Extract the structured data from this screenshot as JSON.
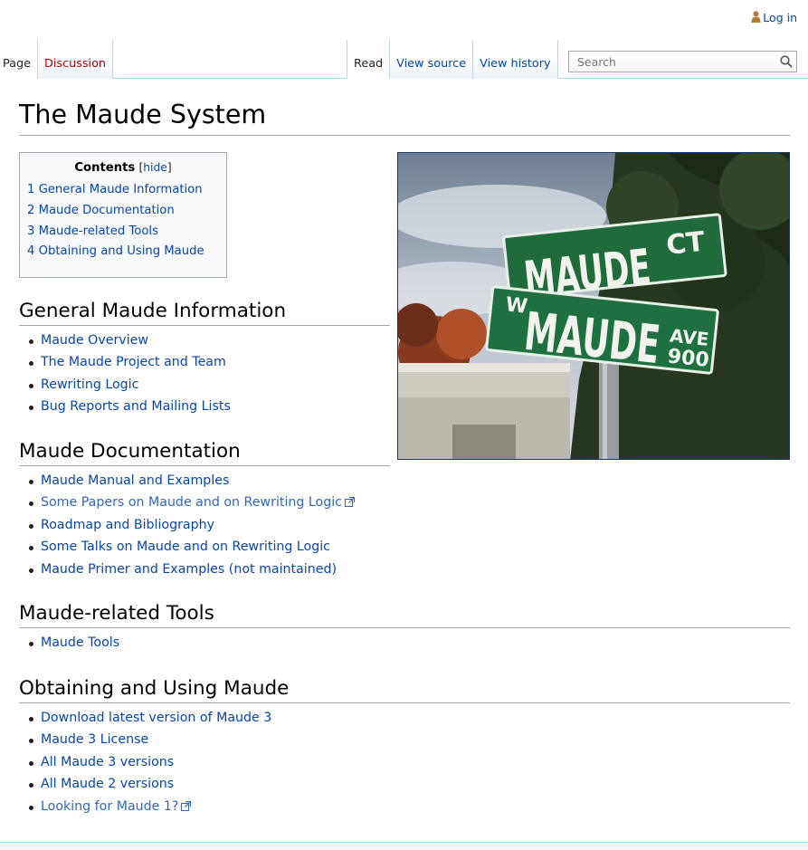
{
  "personal": {
    "login": "Log in",
    "icon": "user-icon"
  },
  "tabs": {
    "left": [
      {
        "label": "Page",
        "selected": true
      },
      {
        "label": "Discussion",
        "selected": false,
        "new": true
      }
    ],
    "right": [
      {
        "label": "Read",
        "selected": true
      },
      {
        "label": "View source"
      },
      {
        "label": "View history"
      }
    ]
  },
  "search": {
    "placeholder": "Search",
    "value": "",
    "icon": "search-icon"
  },
  "page": {
    "title": "The Maude System"
  },
  "toc": {
    "title": "Contents",
    "toggle": "hide",
    "items": [
      "1 General Maude Information",
      "2 Maude Documentation",
      "3 Maude-related Tools",
      "4 Obtaining and Using Maude"
    ]
  },
  "photo": {
    "sign1_word": "MAUDE",
    "sign1_suffix": "CT",
    "sign2_prefix": "W",
    "sign2_word": "MAUDE",
    "sign2_suffix_top": "AVE",
    "sign2_suffix_bottom": "900"
  },
  "sections": [
    {
      "heading": "General Maude Information",
      "links": [
        {
          "text": "Maude Overview"
        },
        {
          "text": "The Maude Project and Team"
        },
        {
          "text": "Rewriting Logic"
        },
        {
          "text": "Bug Reports and Mailing Lists"
        }
      ]
    },
    {
      "heading": "Maude Documentation",
      "links": [
        {
          "text": "Maude Manual and Examples"
        },
        {
          "text": "Some Papers on Maude and on Rewriting Logic",
          "external": true
        },
        {
          "text": "Roadmap and Bibliography"
        },
        {
          "text": "Some Talks on Maude and on Rewriting Logic"
        },
        {
          "text": "Maude Primer and Examples (not maintained)"
        }
      ]
    },
    {
      "heading": "Maude-related Tools",
      "links": [
        {
          "text": "Maude Tools"
        }
      ]
    },
    {
      "heading": "Obtaining and Using Maude",
      "links": [
        {
          "text": "Download latest version of Maude 3"
        },
        {
          "text": "Maude 3 License"
        },
        {
          "text": "All Maude 3 versions"
        },
        {
          "text": "All Maude 2 versions"
        },
        {
          "text": "Looking for Maude 1?",
          "external": true
        }
      ]
    }
  ],
  "colors": {
    "link": "#0645ad",
    "external_link": "#3366bb",
    "new_link": "#ba0000",
    "sign_green": "#1f6b3a"
  }
}
